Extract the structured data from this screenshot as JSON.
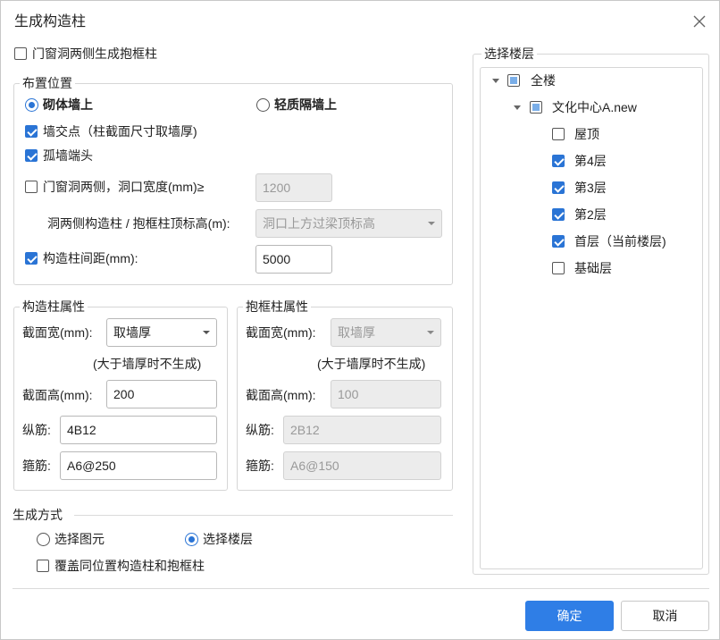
{
  "title": "生成构造柱",
  "gen_both_sides": {
    "label": "门窗洞两侧生成抱框柱",
    "checked": false
  },
  "placement": {
    "label": "布置位置",
    "radio_masonry": {
      "label": "砌体墙上",
      "selected": true
    },
    "radio_light": {
      "label": "轻质隔墙上",
      "selected": false
    },
    "wall_intersection": {
      "label": "墙交点（柱截面尺寸取墙厚)",
      "checked": true
    },
    "isolated_end": {
      "label": "孤墙端头",
      "checked": true
    },
    "opening_sides": {
      "label": "门窗洞两侧，洞口宽度(mm)≥",
      "checked": false,
      "value": "1200"
    },
    "top_elev": {
      "label": "洞两侧构造柱 / 抱框柱顶标高(m):",
      "value": "洞口上方过梁顶标高"
    },
    "spacing": {
      "label": "构造柱间距(mm):",
      "checked": true,
      "value": "5000"
    }
  },
  "gzz": {
    "label": "构造柱属性",
    "width_label": "截面宽(mm):",
    "width_value": "取墙厚",
    "note": "(大于墙厚时不生成)",
    "height_label": "截面高(mm):",
    "height_value": "200",
    "long_label": "纵筋:",
    "long_value": "4B12",
    "stir_label": "箍筋:",
    "stir_value": "A6@250"
  },
  "bkz": {
    "label": "抱框柱属性",
    "width_label": "截面宽(mm):",
    "width_value": "取墙厚",
    "note": "(大于墙厚时不生成)",
    "height_label": "截面高(mm):",
    "height_value": "100",
    "long_label": "纵筋:",
    "long_value": "2B12",
    "stir_label": "箍筋:",
    "stir_value": "A6@150"
  },
  "method": {
    "label": "生成方式",
    "radio_element": {
      "label": "选择图元",
      "selected": false
    },
    "radio_floor": {
      "label": "选择楼层",
      "selected": true
    },
    "overwrite": {
      "label": "覆盖同位置构造柱和抱框柱",
      "checked": false
    }
  },
  "floors": {
    "label": "选择楼层",
    "root": {
      "label": "全楼"
    },
    "project": {
      "label": "文化中心A.new"
    },
    "items": [
      {
        "label": "屋顶",
        "checked": false
      },
      {
        "label": "第4层",
        "checked": true
      },
      {
        "label": "第3层",
        "checked": true
      },
      {
        "label": "第2层",
        "checked": true
      },
      {
        "label": "首层（当前楼层)",
        "checked": true
      },
      {
        "label": "基础层",
        "checked": false
      }
    ]
  },
  "buttons": {
    "ok": "确定",
    "cancel": "取消"
  },
  "colors": {
    "accent": "#2f7ee6",
    "check": "#2a74d5"
  }
}
